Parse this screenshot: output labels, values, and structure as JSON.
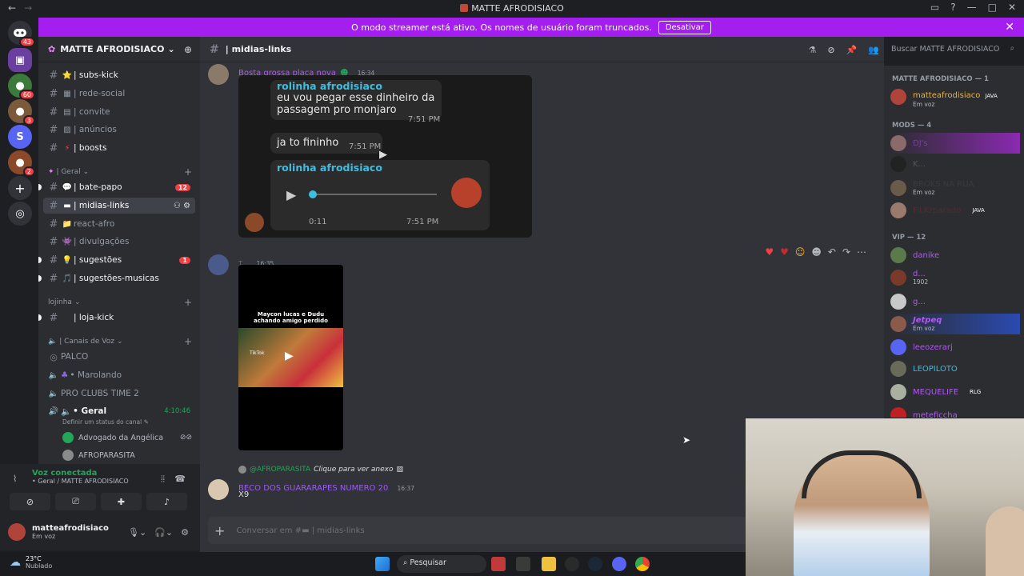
{
  "window": {
    "title": "MATTE AFRODISIACO"
  },
  "banner": {
    "text": "O modo streamer está ativo. Os nomes de usuário foram truncados.",
    "button": "Desativar"
  },
  "guilds": {
    "badges": [
      "43",
      "60",
      "3",
      "2"
    ]
  },
  "server": {
    "name": "MATTE AFRODISIACO"
  },
  "channels": {
    "top": [
      {
        "emoji": "⭐",
        "label": "| subs-kick"
      },
      {
        "emoji": "▦",
        "label": "| rede-social"
      },
      {
        "emoji": "▤",
        "label": "| convite"
      },
      {
        "emoji": "▨",
        "label": "| anúncios"
      },
      {
        "emoji": "⚡",
        "label": "| boosts"
      }
    ],
    "cat_geral": "| Geral",
    "geral": [
      {
        "emoji": "💬",
        "label": "| bate-papo",
        "badge": "12"
      },
      {
        "emoji": "▬",
        "label": "| midias-links"
      },
      {
        "emoji": "📁",
        "label": "react-afro"
      },
      {
        "emoji": "👾",
        "label": "| divulgações"
      },
      {
        "emoji": "💡",
        "label": "| sugestões",
        "badge": "1"
      },
      {
        "emoji": "🎵",
        "label": "| sugestões-musicas"
      }
    ],
    "cat_lojinha": "lojinha",
    "lojinha": [
      {
        "emoji": "",
        "label": "| loja-kick"
      }
    ],
    "cat_voz": "| Canais de Voz",
    "voz": [
      {
        "label": "PALCO"
      },
      {
        "label": "• Marolando"
      },
      {
        "label": "PRO CLUBS TIME 2"
      },
      {
        "label": "• Geral",
        "time": "4:10:46"
      }
    ],
    "status_hint": "Definir um status do canal",
    "voice_users": [
      "Advogado da Angélica",
      "AFROPARASITA"
    ]
  },
  "panel": {
    "voice_title": "Voz conectada",
    "voice_sub": "• Geral / MATTE AFRODISIACO",
    "username": "matteafrodisiaco",
    "status": "Em voz"
  },
  "chat": {
    "channel": "| midias-links",
    "search_placeholder": "Buscar MATTE AFRODISIACO",
    "msg1": {
      "author": "Bosta grossa placa nova",
      "time": "16:34"
    },
    "whatsapp": {
      "name1": "rolinha afrodisiaco",
      "text1": "eu vou pegar esse dinheiro da passagem pro monjaro",
      "time1": "7:51 PM",
      "text2": "ja to fininho",
      "time2": "7:51 PM",
      "name2": "rolinha afrodisiaco",
      "audio_len": "0:11",
      "time3": "7:51 PM"
    },
    "msg2": {
      "author": "T...",
      "time": "16:35",
      "video_caption": "Maycon lucas e Dudu achando amigo perdido",
      "video_brand": "TikTok"
    },
    "msg3": {
      "reply_to": "@AFROPARASITA",
      "reply_text": "Clique para ver anexo",
      "author": "BECO DOS GUARARAPES NUMERO 20",
      "time": "16:37",
      "text": "X9"
    },
    "composer_placeholder": "Conversar em #▬ | midias-links"
  },
  "members": {
    "cat_owner": "MATTE AFRODISIACO — 1",
    "owner": {
      "name": "matteafrodisiaco",
      "tag": "JAVA",
      "status": "Em voz",
      "color": "#f0b232"
    },
    "cat_mods": "MODS — 4",
    "mods": [
      {
        "name": "DJ's",
        "color": "#7a3fa0",
        "sub": ""
      },
      {
        "name": "K...",
        "color": "#2b2b2b",
        "sub": ""
      },
      {
        "name": "BROKS NA RUA",
        "color": "#3a3a3a",
        "sub": "Em voz"
      },
      {
        "name": "FiLKzparado",
        "color": "#ff3b3b",
        "sub": "",
        "tag": "JAVA"
      }
    ],
    "cat_vip": "VIP — 12",
    "vip": [
      {
        "name": "danike",
        "color": "#b05af0",
        "sub": ""
      },
      {
        "name": "d...",
        "color": "#b05af0",
        "sub": "1902"
      },
      {
        "name": "g...",
        "color": "#b05af0",
        "sub": ""
      },
      {
        "name": "Jetpeq",
        "color": "#b05af0",
        "sub": "Em voz"
      },
      {
        "name": "leeozerarj",
        "color": "#b05af0",
        "sub": ""
      },
      {
        "name": "LEOPILOTO",
        "color": "#3dbde0",
        "sub": ""
      },
      {
        "name": "MEQUELIFE",
        "color": "#b05af0",
        "sub": "",
        "tag": "RLG"
      },
      {
        "name": "meteficcha",
        "color": "#b05af0",
        "sub": ""
      }
    ]
  },
  "taskbar": {
    "weather_temp": "23°C",
    "weather_desc": "Nublado",
    "search": "Pesquisar"
  }
}
